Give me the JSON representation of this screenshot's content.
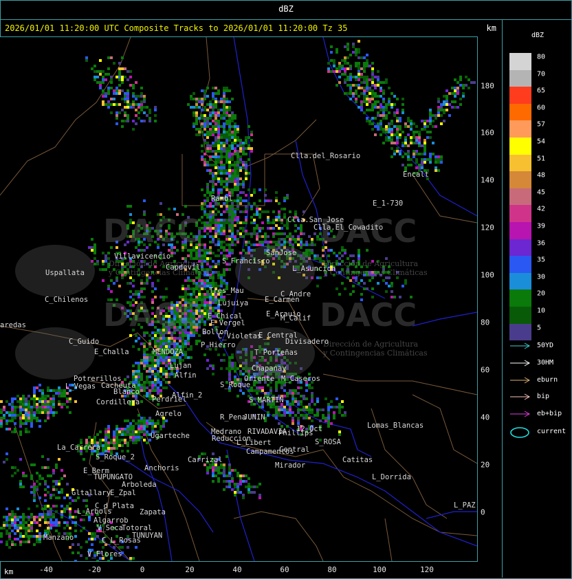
{
  "window": {
    "title": "dBZ"
  },
  "header": {
    "info": "2026/01/01 11:20:00 UTC Composite Tracks to 2026/01/01 11:20:00 Tz 35",
    "km_label": "km"
  },
  "colorbar": {
    "title": "dBZ",
    "levels": [
      {
        "label": "80",
        "color": "#d4d4d4"
      },
      {
        "label": "70",
        "color": "#b4b4b4"
      },
      {
        "label": "65",
        "color": "#ff3c1e"
      },
      {
        "label": "60",
        "color": "#ff6a00"
      },
      {
        "label": "57",
        "color": "#ff9a5a"
      },
      {
        "label": "54",
        "color": "#ffff00"
      },
      {
        "label": "51",
        "color": "#f6c030"
      },
      {
        "label": "48",
        "color": "#d48838"
      },
      {
        "label": "45",
        "color": "#c86a7a"
      },
      {
        "label": "42",
        "color": "#d0348a"
      },
      {
        "label": "39",
        "color": "#b814b0"
      },
      {
        "label": "36",
        "color": "#6c26d2"
      },
      {
        "label": "35",
        "color": "#2a58f2"
      },
      {
        "label": "30",
        "color": "#1a8ed8"
      },
      {
        "label": "20",
        "color": "#0a7a0a"
      },
      {
        "label": "10",
        "color": "#085a08"
      },
      {
        "label": "5",
        "color": "#4a3c8c"
      }
    ]
  },
  "track_legend": [
    {
      "label": "50YD",
      "color": "#40d0d0"
    },
    {
      "label": "30HM",
      "color": "#ffffff"
    },
    {
      "label": "eburn",
      "color": "#e0b070"
    },
    {
      "label": "bip",
      "color": "#ffc0c0"
    },
    {
      "label": "eb+bip",
      "color": "#e040e0"
    },
    {
      "label": "current",
      "color": "#20e0e0"
    }
  ],
  "axes": {
    "y_ticks": [
      "180",
      "160",
      "140",
      "120",
      "100",
      "80",
      "60",
      "40",
      "20",
      "0"
    ],
    "x_ticks": [
      "-40",
      "-20",
      "0",
      "20",
      "40",
      "60",
      "80",
      "100",
      "120"
    ],
    "x_km_label": "km"
  },
  "watermark": {
    "text": "DACC",
    "sub1": "Dirección de Agricultura",
    "sub2": "y Contingencias Climáticas"
  },
  "places": [
    "Clla.del_Rosario",
    "Rambl",
    "Clla.San_Jose",
    "Clla.El_Cowadito",
    "SanJose",
    "E_1-730",
    "Encalt",
    "Villavicencio",
    "Capdevil",
    "S_Francisco",
    "L_Asuncion",
    "Uspallata",
    "C_Chilenos",
    "Tres_Mau",
    "Lujuiya",
    "E_Carmen",
    "C_Andre",
    "E_Chical",
    "E_Arauio",
    "E_Vergel",
    "M_Calif",
    "Bollon",
    "C_Violetas",
    "E_Central",
    "Divisadero",
    "P_Hierro",
    "T_Porteñas",
    "C_Guido",
    "E_Challa",
    "MENDOZA",
    "Lujan",
    "Chapanay",
    "Potrerillos",
    "Cacheuta",
    "Alfin",
    "Oriente",
    "M_Caseros",
    "L_Vegas",
    "Perdriel",
    "S_Roque",
    "S_MARTIN",
    "Agrelo",
    "R_Pena",
    "JUNIN",
    "Alfin_2",
    "Ugarteche",
    "Medrano",
    "RIVADAVIA",
    "Reduccion",
    "L_Libert",
    "Phillips",
    "12_Oct",
    "S_ROSA",
    "Lomas_Blancas",
    "La_Carrera",
    "S_Roque_2",
    "Carrizal",
    "Campamentos",
    "Central",
    "Catitas",
    "E_Berm",
    "TUPUNGATO",
    "Anchoris",
    "Mirador",
    "L_Dorrida",
    "Arboleda",
    "Gltallary",
    "E_Zpal",
    "C_d_Plata",
    "L_Arbols",
    "Zapata",
    "Algarrob",
    "V_Seca",
    "Totoral",
    "TUNUYAN",
    "Manzano",
    "C_L_Rosas",
    "V_Flores",
    "L_PAZ",
    "aredas",
    "Blanco",
    "Cordillera"
  ]
}
